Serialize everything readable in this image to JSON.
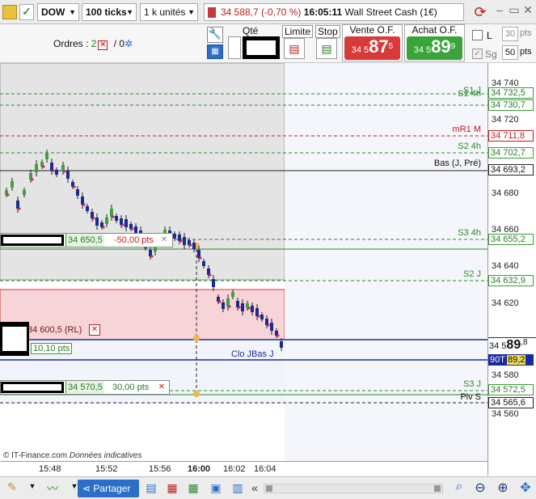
{
  "toolbar": {
    "instrument": "DOW",
    "ticks": "100 ticks",
    "units": "1 k unités",
    "price": "34 588,7",
    "change": "(-0,70 %)",
    "time": "16:05:11",
    "market_name": "Wall Street Cash (1€)"
  },
  "orders": {
    "label": "Ordres :",
    "count_open": "2",
    "separator": "/",
    "count_other": "0"
  },
  "trade": {
    "qty_label": "Qté",
    "limit_label": "Limite",
    "stop_label": "Stop",
    "sell_label": "Vente O.F.",
    "sell_small": "34 5",
    "sell_big": "87",
    "sell_sup": "5",
    "buy_label": "Achat O.F.",
    "buy_small": "34 5",
    "buy_big": "89",
    "buy_sup": "9",
    "opt_l": "L",
    "opt_sg": "Sg",
    "val_30": "30",
    "val_pts": "pts",
    "val_50": "50",
    "val_pts2": "pts"
  },
  "chart_levels": [
    {
      "label": "S1 J",
      "value": "34 732,5",
      "color": "#2a8a2a"
    },
    {
      "label": "S1 4h",
      "value": "34 730,7",
      "color": "#2a8a2a"
    },
    {
      "label": "mR1 M",
      "value": "34 711,8",
      "color": "#c21b1b"
    },
    {
      "label": "S2 4h",
      "value": "34 702,7",
      "color": "#2a8a2a"
    },
    {
      "label": "Bas (J, Pré)",
      "value": "34 693,2",
      "color": "#111111"
    },
    {
      "label": "S3 4h",
      "value": "34 655,2",
      "color": "#2a8a2a"
    },
    {
      "label": "S2 J",
      "value": "34 632,9",
      "color": "#2a8a2a"
    },
    {
      "label": "S3 J",
      "value": "34 572,5",
      "color": "#2a8a2a"
    },
    {
      "label": "Piv S",
      "value": "34 565,6",
      "color": "#111111"
    }
  ],
  "yaxis": [
    "34 740",
    "34 720",
    "34 680",
    "34 660",
    "34 640",
    "34 620",
    "34 580",
    "34 560"
  ],
  "order_tags": {
    "o1_price": "34 650,5",
    "o1_pts": "-50,00 pts",
    "o2_price": "34 600,5 (RL)",
    "o2_pts": "10,10 pts",
    "o3_price": "34 570,5",
    "o3_pts": "30,00 pts"
  },
  "current": {
    "bid_small": "34 5",
    "bid_big": "89",
    "bid_sup": ",8",
    "ask_label": "90T",
    "ask_value": "89,2",
    "under_value": "34 589,2"
  },
  "annotations": {
    "clo_jbas": "Clo JBas J",
    "source": "© IT-Finance.com",
    "disclaimer": "Données indicatives"
  },
  "xaxis": [
    "15:48",
    "15:52",
    "15:56",
    "16:00",
    "16:02",
    "16:04"
  ],
  "bottom": {
    "share_label": "Partager"
  }
}
